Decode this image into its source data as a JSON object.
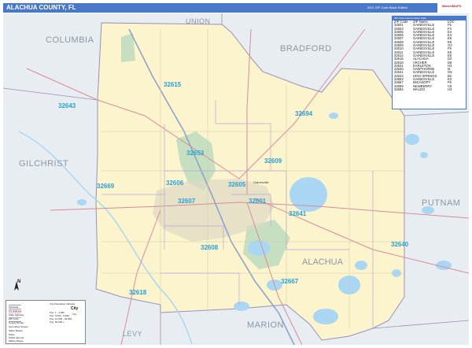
{
  "header": {
    "title": "ALACHUA COUNTY, FL",
    "edition": "2021 ZIP Code Basic Edition",
    "logo_text": "MarketMAPS"
  },
  "map": {
    "counties_outside": [
      {
        "name": "UNION"
      },
      {
        "name": "COLUMBIA"
      },
      {
        "name": "BRADFORD"
      },
      {
        "name": "GILCHRIST"
      },
      {
        "name": "PUTNAM"
      },
      {
        "name": "MARION"
      },
      {
        "name": "LEVY"
      }
    ],
    "county_inside_label": "ALACHUA",
    "zip_labels": [
      "32615",
      "32643",
      "32694",
      "32653",
      "32609",
      "32606",
      "32605",
      "32669",
      "32607",
      "32601",
      "32641",
      "32608",
      "32640",
      "32667",
      "32618"
    ],
    "city_labels": [
      "Gainesville"
    ]
  },
  "zip_table": {
    "title": "ZIP Code Index/Location Table",
    "headers": [
      "ZIP Code",
      "ZIP Name",
      "LOC"
    ],
    "rows": [
      [
        "32601",
        "GAINESVILLE",
        "F5"
      ],
      [
        "32603",
        "GAINESVILLE",
        "F4"
      ],
      [
        "32605",
        "GAINESVILLE",
        "E4"
      ],
      [
        "32606",
        "GAINESVILLE",
        "E4"
      ],
      [
        "32607",
        "GAINESVILLE",
        "E5"
      ],
      [
        "32608",
        "GAINESVILLE",
        "E5"
      ],
      [
        "32609",
        "GAINESVILLE",
        "G3"
      ],
      [
        "32610",
        "GAINESVILLE",
        "F5"
      ],
      [
        "32611",
        "GAINESVILLE",
        "E5"
      ],
      [
        "32612",
        "GAINESVILLE",
        "E5"
      ],
      [
        "32615",
        "ALACHUA",
        "D2"
      ],
      [
        "32618",
        "ARCHER",
        "D6"
      ],
      [
        "32631",
        "EARLETON",
        "H3"
      ],
      [
        "32640",
        "HAWTHORNE",
        "I5"
      ],
      [
        "32641",
        "GAINESVILLE",
        "G5"
      ],
      [
        "32643",
        "HIGH SPRINGS",
        "B2"
      ],
      [
        "32653",
        "GAINESVILLE",
        "E3"
      ],
      [
        "32667",
        "MICANOPY",
        "F6"
      ],
      [
        "32669",
        "NEWBERRY",
        "C5"
      ],
      [
        "32694",
        "WALDO",
        "H3"
      ]
    ]
  },
  "legend": {
    "items": [
      "Interstate",
      "US Highway",
      "State Highway",
      "ZIP Code",
      "County Border",
      "Secondary Streets",
      "Water Bodies",
      "Parks",
      "Public Airports",
      "Military Bases"
    ],
    "items_right": [
      "City Population Indicator"
    ],
    "population_tiers": [
      "Pop. 1 - 4,999",
      "Pop. 5,000 - 9,999",
      "Pop. 10,000 - 49,999",
      "Pop. 50,000 +"
    ],
    "city_glyph_large": "City",
    "city_glyph_small": "City"
  },
  "compass": {
    "north": "N"
  },
  "colors": {
    "county_fill": "#fbf4cc",
    "outside_fill": "#e8edf2",
    "water": "#a9d6f2",
    "park": "#c6dfc0",
    "zip_label": "#27a0d8",
    "header_bg": "#4a78c8",
    "road_pink": "#d98a9c",
    "road_blue": "#8fa2c8"
  }
}
